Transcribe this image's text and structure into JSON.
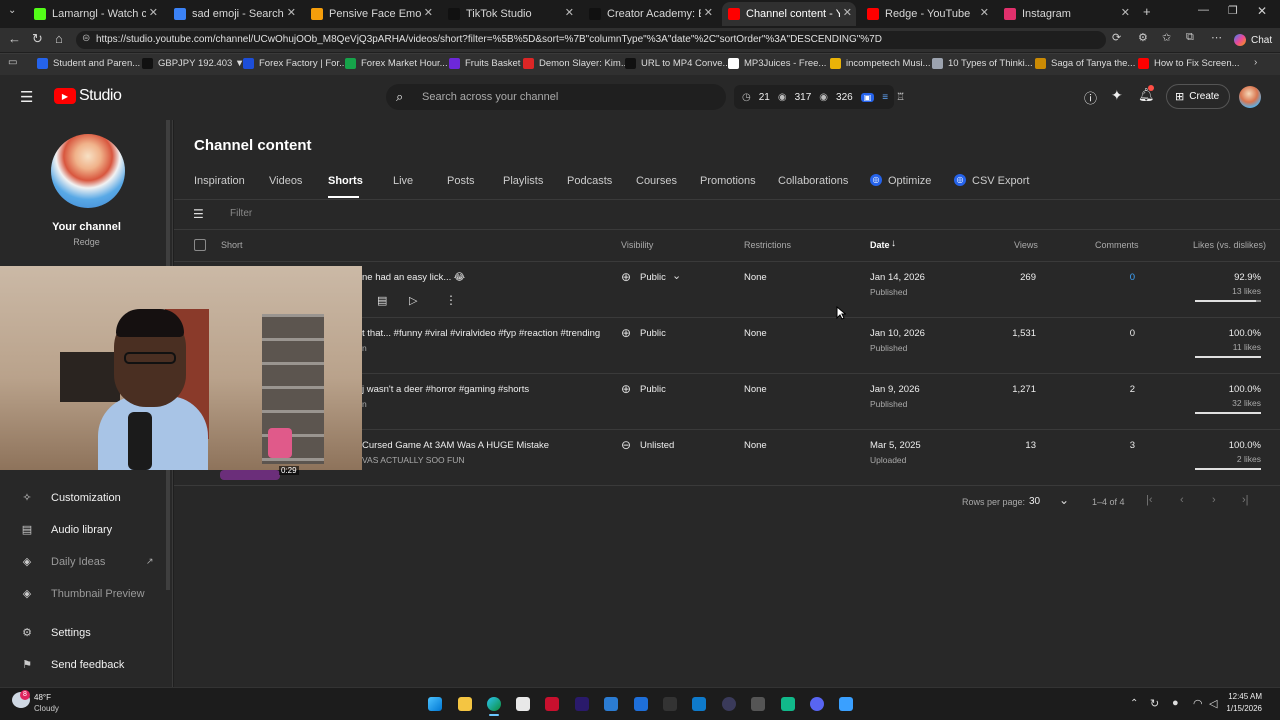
{
  "browser": {
    "tabs": [
      {
        "title": "Lamarngl - Watch clips on K",
        "color": "#53fc18"
      },
      {
        "title": "sad emoji - Search",
        "color": "#3b82f6"
      },
      {
        "title": "Pensive Face Emoji: Mea",
        "color": "#f59e0b"
      },
      {
        "title": "TikTok Studio",
        "color": "#111111"
      },
      {
        "title": "Creator Academy: Empower",
        "color": "#111111"
      },
      {
        "title": "Channel content - YouTube",
        "color": "#ff0000"
      },
      {
        "title": "Redge - YouTube",
        "color": "#ff0000"
      },
      {
        "title": "Instagram",
        "color": "#e1306c"
      }
    ],
    "url": "https://studio.youtube.com/channel/UCwOhujOOb_M8QeVjQ3pARHA/videos/short?filter=%5B%5D&sort=%7B\"columnType\"%3A\"date\"%2C\"sortOrder\"%3A\"DESCENDING\"%7D",
    "chat_label": "Chat",
    "bookmarks": [
      {
        "label": "Student and Paren...",
        "color": "#2563eb"
      },
      {
        "label": "GBPJPY 192.403 ▼...",
        "color": "#111111"
      },
      {
        "label": "Forex Factory | For...",
        "color": "#1d4ed8"
      },
      {
        "label": "Forex Market Hour...",
        "color": "#16a34a"
      },
      {
        "label": "Fruits Basket",
        "color": "#6d28d9"
      },
      {
        "label": "Demon Slayer: Kim...",
        "color": "#dc2626"
      },
      {
        "label": "URL to MP4 Conve...",
        "color": "#111111"
      },
      {
        "label": "MP3Juices - Free...",
        "color": "#ffffff"
      },
      {
        "label": "incompetech Musi...",
        "color": "#eab308"
      },
      {
        "label": "10 Types of Thinki...",
        "color": "#9ca3af"
      },
      {
        "label": "Saga of Tanya the...",
        "color": "#ca8a04"
      },
      {
        "label": "How to Fix Screen...",
        "color": "#ff0000"
      }
    ]
  },
  "studio": {
    "logo_text": "Studio",
    "search_placeholder": "Search across your channel",
    "stats": [
      "21",
      "317",
      "326"
    ],
    "create_label": "Create"
  },
  "sidebar": {
    "channel_title": "Your channel",
    "channel_name": "Redge",
    "items": [
      {
        "label": "Customization",
        "icon": "magic-wand-icon"
      },
      {
        "label": "Audio library",
        "icon": "audio-library-icon"
      },
      {
        "label": "Daily Ideas",
        "icon": "ideas-icon"
      },
      {
        "label": "Thumbnail Preview",
        "icon": "thumbnail-icon"
      },
      {
        "label": "Settings",
        "icon": "gear-icon"
      },
      {
        "label": "Send feedback",
        "icon": "feedback-icon"
      }
    ]
  },
  "content": {
    "title": "Channel content",
    "tabs": [
      "Inspiration",
      "Videos",
      "Shorts",
      "Live",
      "Posts",
      "Playlists",
      "Podcasts",
      "Courses",
      "Promotions",
      "Collaborations",
      "Optimize",
      "CSV Export"
    ],
    "active_tab": "Shorts",
    "filter_placeholder": "Filter",
    "columns": [
      "Short",
      "Visibility",
      "Restrictions",
      "Date",
      "Views",
      "Comments",
      "Likes (vs. dislikes)"
    ],
    "rows": [
      {
        "title": "ne had an easy lick... 😂",
        "desc": "",
        "visibility": "Public",
        "restrictions": "None",
        "date": "Jan 14, 2026",
        "date_status": "Published",
        "views": "269",
        "comments": "0",
        "likes_pct": "92.9%",
        "likes": "13 likes"
      },
      {
        "title": "t that... #funny #viral #viralvideo #fyp #reaction #trending ...",
        "desc": "n",
        "visibility": "Public",
        "restrictions": "None",
        "date": "Jan 10, 2026",
        "date_status": "Published",
        "views": "1,531",
        "comments": "0",
        "likes_pct": "100.0%",
        "likes": "11 likes"
      },
      {
        "title": "j wasn't a deer #horror #gaming #shorts",
        "desc": "n",
        "visibility": "Public",
        "restrictions": "None",
        "date": "Jan 9, 2026",
        "date_status": "Published",
        "views": "1,271",
        "comments": "2",
        "likes_pct": "100.0%",
        "likes": "32 likes"
      },
      {
        "title": "Cursed Game At 3AM Was A HUGE Mistake",
        "desc": "VAS ACTUALLY SOO FUN",
        "visibility": "Unlisted",
        "restrictions": "None",
        "date": "Mar 5, 2025",
        "date_status": "Uploaded",
        "views": "13",
        "comments": "3",
        "likes_pct": "100.0%",
        "likes": "2 likes"
      }
    ],
    "pagination": {
      "rows_per_page_label": "Rows per page:",
      "rows_per_page": "30",
      "range": "1–4 of 4"
    },
    "webcam_timestamp": "0:29"
  },
  "taskbar": {
    "weather_temp": "48°F",
    "weather_desc": "Cloudy",
    "weather_badge": "8",
    "time": "12:45 AM",
    "date": "1/15/2026"
  }
}
